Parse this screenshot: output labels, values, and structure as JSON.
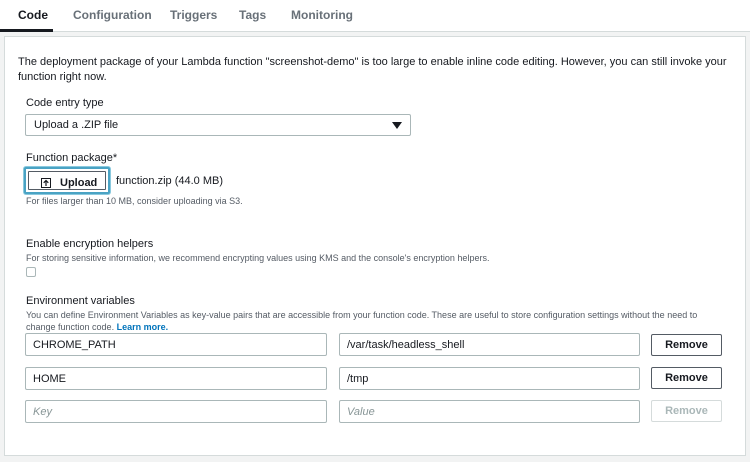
{
  "tabs": [
    {
      "label": "Code"
    },
    {
      "label": "Configuration"
    },
    {
      "label": "Triggers"
    },
    {
      "label": "Tags"
    },
    {
      "label": "Monitoring"
    }
  ],
  "notice": "The deployment package of your Lambda function \"screenshot-demo\" is too large to enable inline code editing. However, you can still invoke your function right now.",
  "code_entry": {
    "label": "Code entry type",
    "selected": "Upload a .ZIP file",
    "icon": "caret-down-icon"
  },
  "function_package": {
    "label": "Function package*",
    "upload_label": "Upload",
    "upload_icon": "upload-icon",
    "file": "function.zip (44.0 MB)",
    "hint": "For files larger than 10 MB, consider uploading via S3."
  },
  "encryption": {
    "label": "Enable encryption helpers",
    "hint": "For storing sensitive information, we recommend encrypting values using KMS and the console's encryption helpers.",
    "checked": false
  },
  "env": {
    "label": "Environment variables",
    "hint": "You can define Environment Variables as key-value pairs that are accessible from your function code. These are useful to store configuration settings without the need to change function code.",
    "learn_more": "Learn more.",
    "rows": [
      {
        "key": "CHROME_PATH",
        "value": "/var/task/headless_shell",
        "remove": "Remove"
      },
      {
        "key": "HOME",
        "value": "/tmp",
        "remove": "Remove"
      }
    ],
    "new_row": {
      "key_placeholder": "Key",
      "value_placeholder": "Value",
      "remove": "Remove"
    }
  },
  "colors": {
    "accent": "#0073bb",
    "focus": "#4aa3c4",
    "border": "#aab7b8"
  }
}
